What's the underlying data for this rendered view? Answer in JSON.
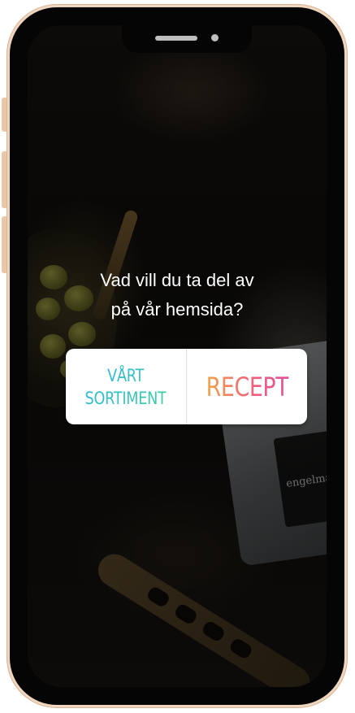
{
  "story": {
    "question": "Vad vill du ta del av\npå vår hemsida?",
    "poll": {
      "options": [
        {
          "label": "VÅRT\nSORTIMENT"
        },
        {
          "label": "RECEPT"
        }
      ]
    },
    "background_photo": {
      "brand_text": "engelmanns"
    }
  },
  "colors": {
    "frame": "#efd6bf",
    "bezel": "#050505",
    "option_left_gradient": [
      "#2fb2e8",
      "#3bcf9a"
    ],
    "option_right_gradient": [
      "#f5a34a",
      "#f2607a",
      "#e0509c"
    ],
    "question_text": "#ffffff"
  },
  "icons": {
    "speaker": "speaker-grille-icon",
    "camera": "front-camera-icon"
  }
}
